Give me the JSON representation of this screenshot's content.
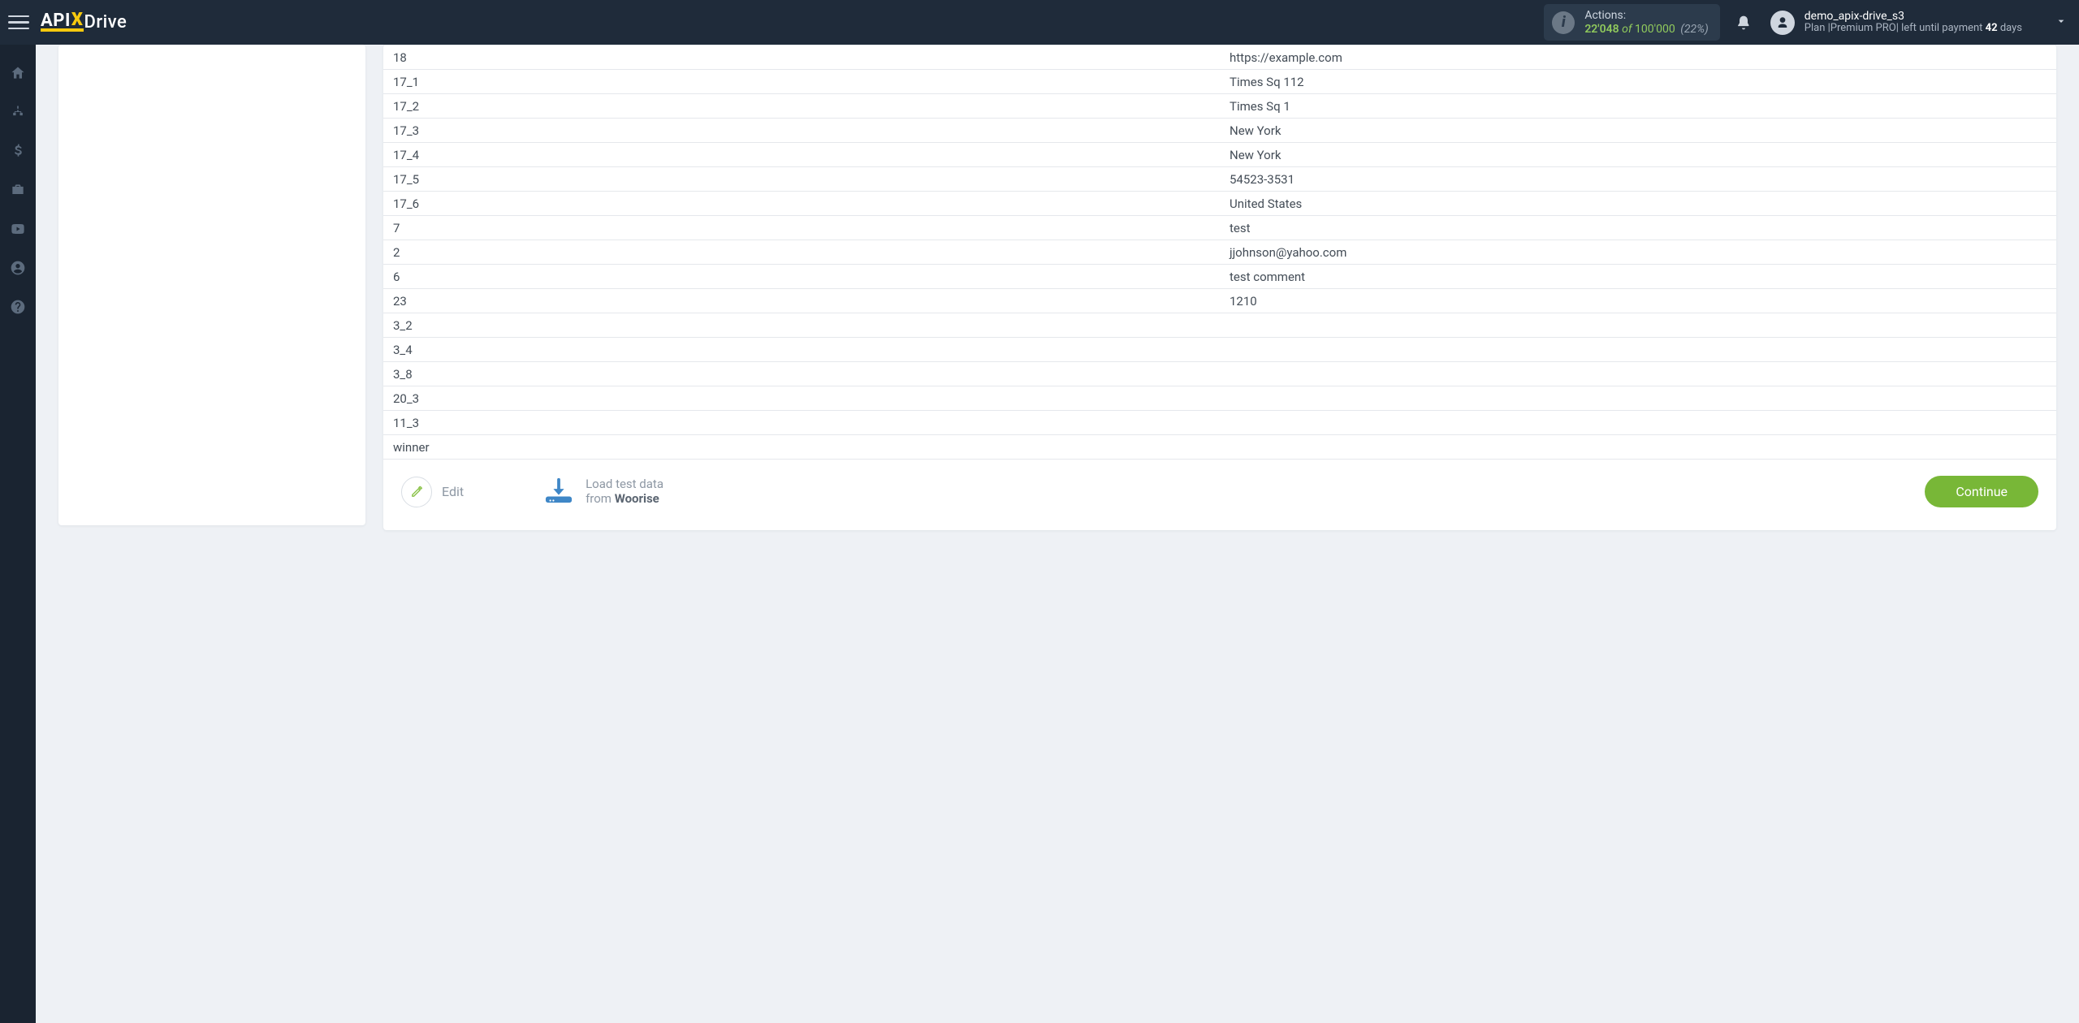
{
  "header": {
    "logo": {
      "part1": "API",
      "part2": "X",
      "part3": "Drive"
    },
    "actions": {
      "label": "Actions:",
      "used": "22'048",
      "of_word": "of",
      "total": "100'000",
      "pct": "(22%)"
    },
    "user": {
      "username": "demo_apix-drive_s3",
      "plan_prefix": "Plan |",
      "plan_name": "Premium PRO",
      "plan_suffix": "| left until payment ",
      "days_count": "42",
      "days_word": " days"
    }
  },
  "table": {
    "rows": [
      {
        "key": "18",
        "val": "https://example.com"
      },
      {
        "key": "17_1",
        "val": "Times Sq 112"
      },
      {
        "key": "17_2",
        "val": "Times Sq 1"
      },
      {
        "key": "17_3",
        "val": "New York"
      },
      {
        "key": "17_4",
        "val": "New York"
      },
      {
        "key": "17_5",
        "val": "54523-3531"
      },
      {
        "key": "17_6",
        "val": "United States"
      },
      {
        "key": "7",
        "val": "test"
      },
      {
        "key": "2",
        "val": "jjohnson@yahoo.com"
      },
      {
        "key": "6",
        "val": "test comment"
      },
      {
        "key": "23",
        "val": "1210"
      },
      {
        "key": "3_2",
        "val": ""
      },
      {
        "key": "3_4",
        "val": ""
      },
      {
        "key": "3_8",
        "val": ""
      },
      {
        "key": "20_3",
        "val": ""
      },
      {
        "key": "11_3",
        "val": ""
      },
      {
        "key": "winner",
        "val": ""
      }
    ]
  },
  "actions_row": {
    "edit": "Edit",
    "load_line1": "Load test data",
    "load_line2_prefix": "from ",
    "load_line2_bold": "Woorise",
    "continue": "Continue"
  }
}
